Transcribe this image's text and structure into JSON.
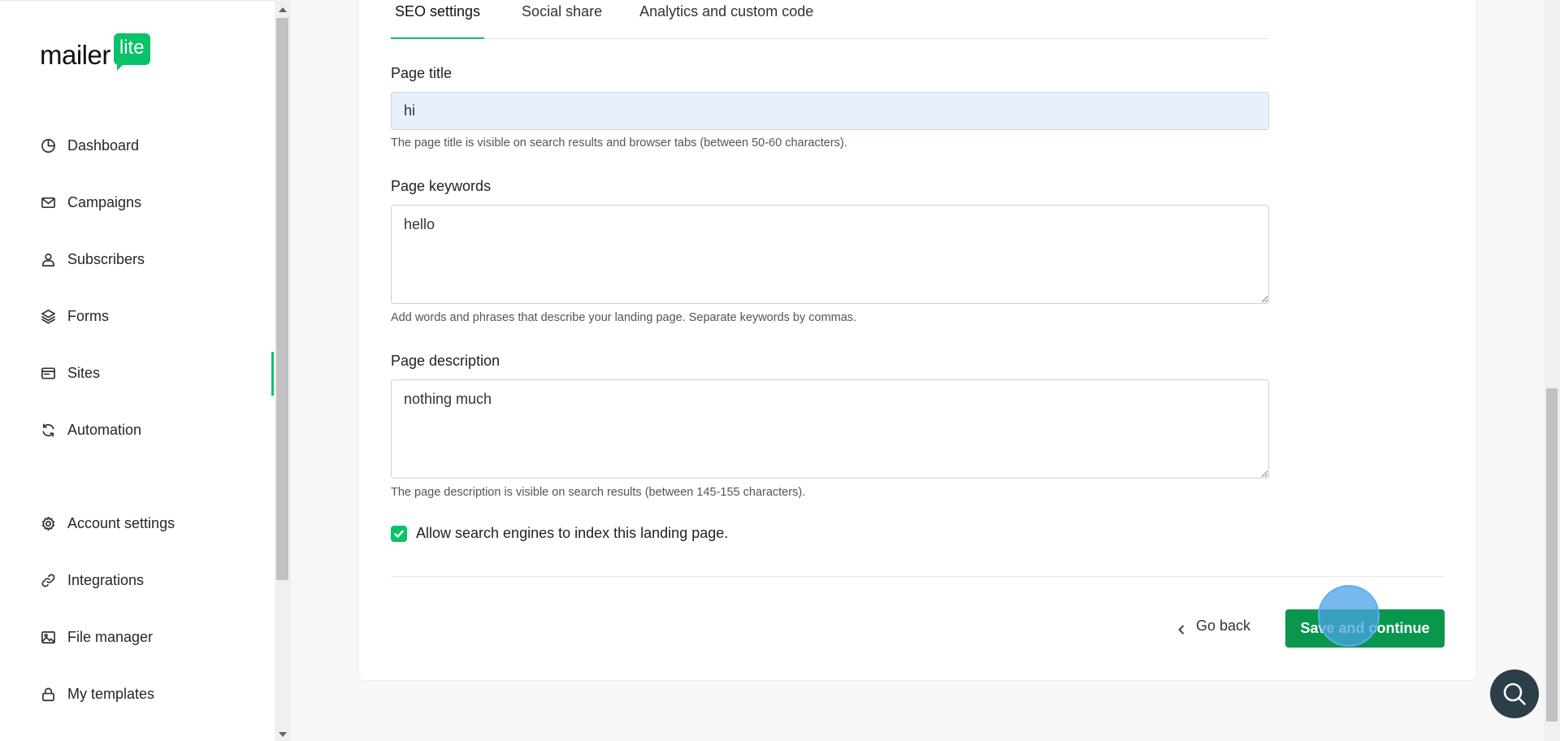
{
  "brand": {
    "logo_text": "mailer",
    "logo_badge": "lite",
    "accent_color": "#09c269",
    "button_color": "#09964d"
  },
  "sidebar": {
    "items": [
      {
        "label": "Dashboard",
        "icon": "clock-pie-icon"
      },
      {
        "label": "Campaigns",
        "icon": "envelope-icon"
      },
      {
        "label": "Subscribers",
        "icon": "person-icon"
      },
      {
        "label": "Forms",
        "icon": "layers-icon"
      },
      {
        "label": "Sites",
        "icon": "browser-window-icon",
        "active": true
      },
      {
        "label": "Automation",
        "icon": "refresh-icon"
      },
      {
        "label": "Account settings",
        "icon": "gear-icon"
      },
      {
        "label": "Integrations",
        "icon": "link-icon"
      },
      {
        "label": "File manager",
        "icon": "image-icon"
      },
      {
        "label": "My templates",
        "icon": "lock-icon"
      }
    ]
  },
  "tabs": [
    {
      "label": "SEO settings",
      "active": true
    },
    {
      "label": "Social share"
    },
    {
      "label": "Analytics and custom code"
    }
  ],
  "form": {
    "page_title": {
      "label": "Page title",
      "value": "hi",
      "help": "The page title is visible on search results and browser tabs (between 50-60 characters)."
    },
    "page_keywords": {
      "label": "Page keywords",
      "value": "hello",
      "help": "Add words and phrases that describe your landing page. Separate keywords by commas."
    },
    "page_description": {
      "label": "Page description",
      "value": "nothing much",
      "help": "The page description is visible on search results (between 145-155 characters)."
    },
    "index_checkbox": {
      "label": "Allow search engines to index this landing page.",
      "checked": true
    }
  },
  "actions": {
    "go_back": "Go back",
    "save": "Save and continue"
  }
}
